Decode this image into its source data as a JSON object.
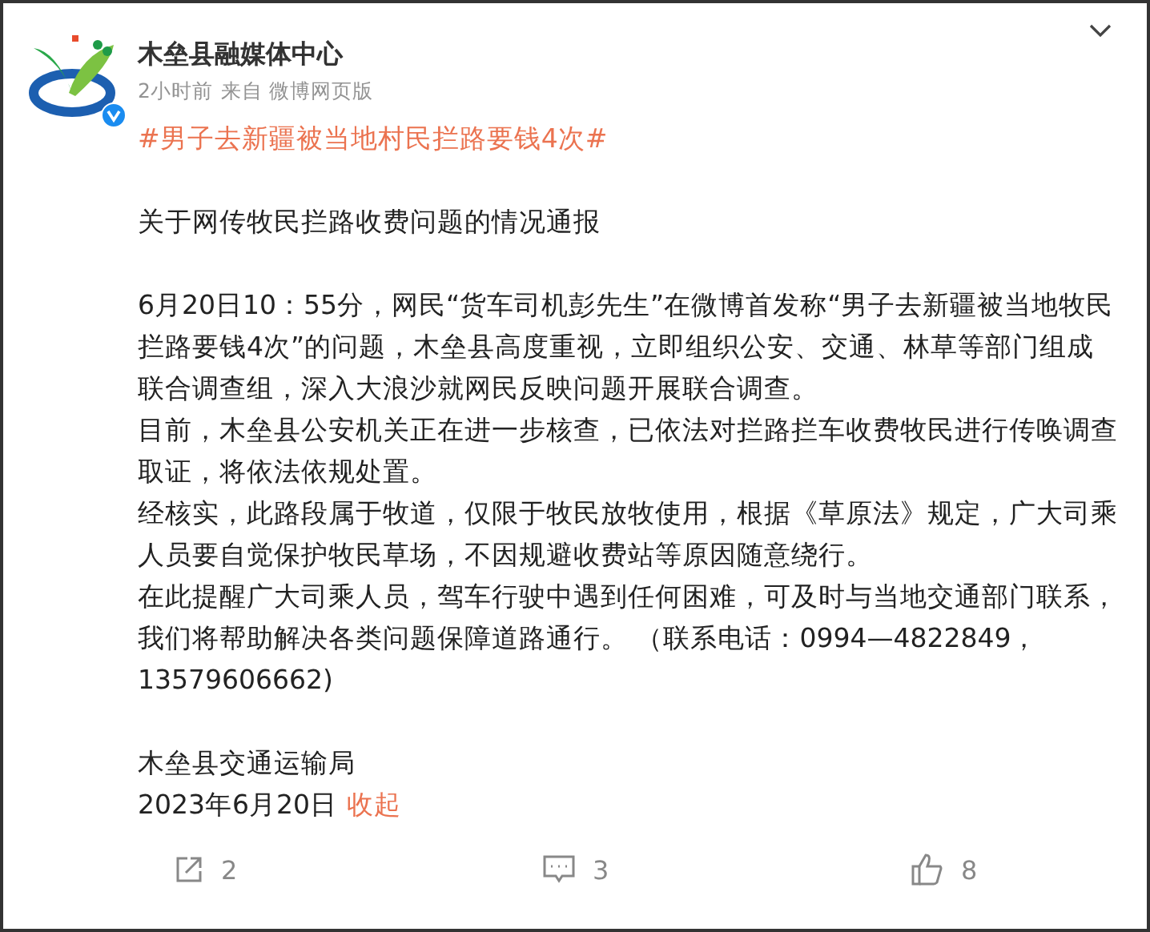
{
  "post": {
    "author": "木垒县融媒体中心",
    "verified": true,
    "time": "2小时前",
    "source": "来自 微博网页版",
    "hashtag": "#男子去新疆被当地村民拦路要钱4次#",
    "sections": [
      [
        "关于网传牧民拦路收费问题的情况通报"
      ],
      [
        "6月20日10：55分，网民“货车司机彭先生”在微博首发称“男子去新疆被当地牧民拦路要钱4次”的问题，木垒县高度重视，立即组织公安、交通、林草等部门组成联合调查组，深入大浪沙就网民反映问题开展联合调查。",
        "目前，木垒县公安机关正在进一步核查，已依法对拦路拦车收费牧民进行传唤调查取证，将依法依规处置。",
        "经核实，此路段属于牧道，仅限于牧民放牧使用，根据《草原法》规定，广大司乘人员要自觉保护牧民草场，不因规避收费站等原因随意绕行。",
        "在此提醒广大司乘人员，驾车行驶中遇到任何困难，可及时与当地交通部门联系，我们将帮助解决各类问题保障道路通行。 （联系电话：0994—4822849，13579606662)"
      ],
      [
        "木垒县交通运输局"
      ]
    ],
    "date": "2023年6月20日",
    "collapse": "收起"
  },
  "actions": [
    {
      "kind": "share",
      "count": "2"
    },
    {
      "kind": "comment",
      "count": "3"
    },
    {
      "kind": "like",
      "count": "8"
    }
  ]
}
